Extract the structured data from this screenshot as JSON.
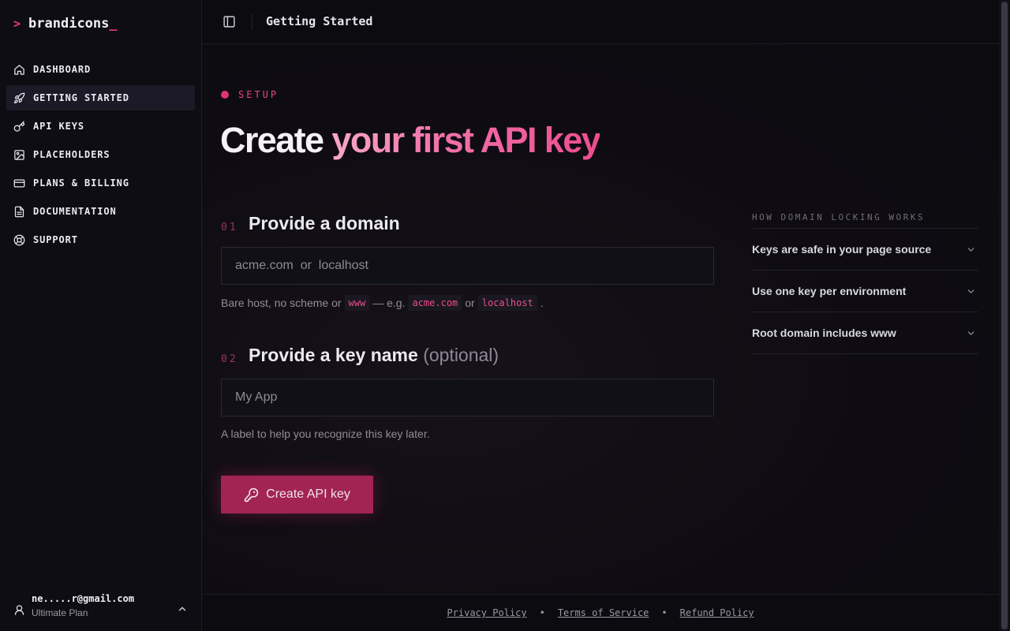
{
  "app": {
    "logo_prompt": ">",
    "logo_text": "brandicons",
    "logo_cursor": "_"
  },
  "sidebar": {
    "items": [
      {
        "label": "DASHBOARD",
        "icon": "home-icon"
      },
      {
        "label": "GETTING STARTED",
        "icon": "rocket-icon",
        "active": true
      },
      {
        "label": "API KEYS",
        "icon": "key-icon"
      },
      {
        "label": "PLACEHOLDERS",
        "icon": "image-icon"
      },
      {
        "label": "PLANS & BILLING",
        "icon": "credit-card-icon"
      },
      {
        "label": "DOCUMENTATION",
        "icon": "document-icon"
      },
      {
        "label": "SUPPORT",
        "icon": "lifebuoy-icon"
      }
    ],
    "user": {
      "email": "ne.....r@gmail.com",
      "plan": "Ultimate Plan"
    }
  },
  "topbar": {
    "title": "Getting Started"
  },
  "main": {
    "eyebrow": "SETUP",
    "headline_plain": "Create ",
    "headline_accent": "your first API key",
    "step1": {
      "number": "01",
      "title": "Provide a domain",
      "placeholder": "acme.com  or  localhost",
      "value": "",
      "hint_prefix": "Bare host, no scheme or",
      "hint_code_1": "www",
      "hint_middle": "— e.g.",
      "hint_code_2": "acme.com",
      "hint_or": "or",
      "hint_code_3": "localhost",
      "hint_suffix": "."
    },
    "step2": {
      "number": "02",
      "title": "Provide a key name",
      "title_optional": "(optional)",
      "placeholder": "My App",
      "value": "",
      "hint": "A label to help you recognize this key later."
    },
    "cta_label": "Create API key"
  },
  "info": {
    "heading": "HOW DOMAIN LOCKING WORKS",
    "items": [
      "Keys are safe in your page source",
      "Use one key per environment",
      "Root domain includes www"
    ]
  },
  "footer": {
    "links": [
      "Privacy Policy",
      "Terms of Service",
      "Refund Policy"
    ],
    "separator": "•"
  },
  "colors": {
    "accent": "#ec3a78",
    "cta": "#a12452",
    "background": "#0c0b10"
  }
}
